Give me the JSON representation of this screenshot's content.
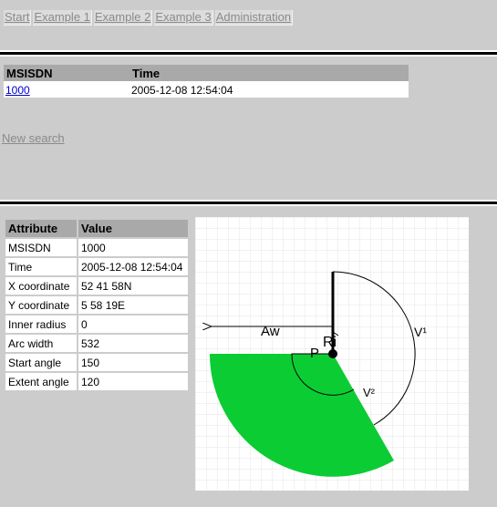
{
  "nav": [
    "Start",
    "Example 1",
    "Example 2",
    "Example 3",
    "Administration"
  ],
  "results": {
    "headers": [
      "MSISDN",
      "Time"
    ],
    "rows": [
      [
        "1000",
        "2005-12-08 12:54:04"
      ]
    ]
  },
  "new_search": "New search",
  "attributes": {
    "headers": [
      "Attribute",
      "Value"
    ],
    "rows": [
      [
        "MSISDN",
        "1000"
      ],
      [
        "Time",
        "2005-12-08 12:54:04"
      ],
      [
        "X coordinate",
        "52 41 58N"
      ],
      [
        "Y coordinate",
        "5 58 19E"
      ],
      [
        "Inner radius",
        "0"
      ],
      [
        "Arc width",
        "532"
      ],
      [
        "Start angle",
        "150"
      ],
      [
        "Extent angle",
        "120"
      ]
    ]
  },
  "diagram": {
    "labels": {
      "aw": "Aw",
      "ri": "Ri",
      "p": "P",
      "v1": "V¹",
      "v2": "V²"
    },
    "colors": {
      "sector": "#0ccc33",
      "grid": "#e6e6e6",
      "background": "#ffffff"
    }
  }
}
